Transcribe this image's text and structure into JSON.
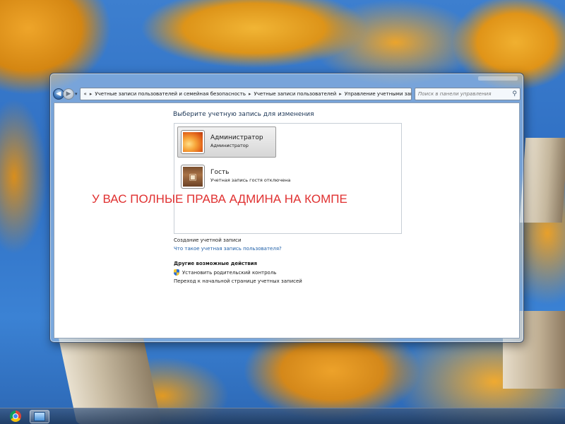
{
  "window": {
    "address": {
      "crumbs": [
        "Учетные записи пользователей и семейная безопасность",
        "Учетные записи пользователей",
        "Управление учетными записями"
      ],
      "overflow_glyph": "«",
      "separator": "▸",
      "dropdown_glyph": "▾",
      "refresh_glyph": "⟳"
    },
    "search": {
      "placeholder": "Поиск в панели управления"
    },
    "nav": {
      "back_glyph": "◀",
      "forward_glyph": "▶",
      "recent_glyph": "▾"
    }
  },
  "main": {
    "title": "Выберите учетную запись для изменения",
    "accounts": [
      {
        "name": "Администратор",
        "subtitle": "Администратор",
        "selected": true,
        "icon": "flower-picture"
      },
      {
        "name": "Гость",
        "subtitle": "Учетная запись гостя отключена",
        "selected": false,
        "icon": "briefcase-picture"
      }
    ],
    "create_link": "Создание учетной записи",
    "what_link": "Что такое учетная запись пользователя?",
    "other_heading": "Другие возможные действия",
    "tasks": [
      {
        "label": "Установить родительский контроль",
        "icon": "shield-icon"
      },
      {
        "label": "Переход к начальной странице учетных записей"
      }
    ]
  },
  "overlay_caption": "У ВАС ПОЛНЫЕ ПРАВА АДМИНА НА КОМПЕ",
  "colors": {
    "overlay_text": "#e03030",
    "link": "#1e5fa8",
    "heading": "#1a3454"
  },
  "taskbar": {
    "items": [
      {
        "icon": "chrome-icon",
        "active": false
      },
      {
        "icon": "control-panel-icon",
        "active": true
      }
    ]
  }
}
